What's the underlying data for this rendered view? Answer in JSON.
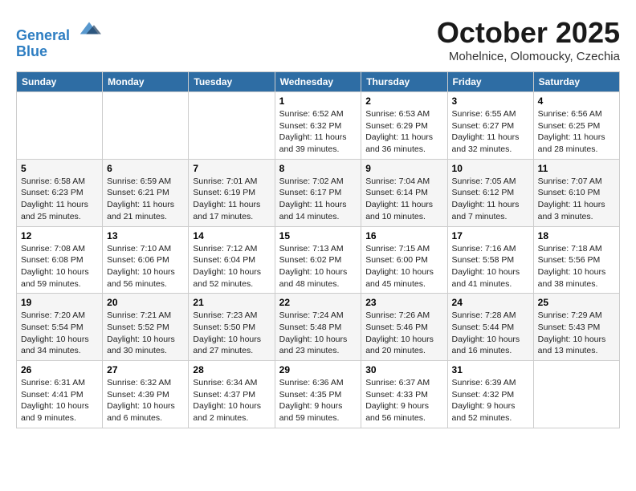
{
  "header": {
    "logo_line1": "General",
    "logo_line2": "Blue",
    "month": "October 2025",
    "location": "Mohelnice, Olomoucky, Czechia"
  },
  "weekdays": [
    "Sunday",
    "Monday",
    "Tuesday",
    "Wednesday",
    "Thursday",
    "Friday",
    "Saturday"
  ],
  "weeks": [
    [
      {
        "day": "",
        "info": ""
      },
      {
        "day": "",
        "info": ""
      },
      {
        "day": "",
        "info": ""
      },
      {
        "day": "1",
        "info": "Sunrise: 6:52 AM\nSunset: 6:32 PM\nDaylight: 11 hours\nand 39 minutes."
      },
      {
        "day": "2",
        "info": "Sunrise: 6:53 AM\nSunset: 6:29 PM\nDaylight: 11 hours\nand 36 minutes."
      },
      {
        "day": "3",
        "info": "Sunrise: 6:55 AM\nSunset: 6:27 PM\nDaylight: 11 hours\nand 32 minutes."
      },
      {
        "day": "4",
        "info": "Sunrise: 6:56 AM\nSunset: 6:25 PM\nDaylight: 11 hours\nand 28 minutes."
      }
    ],
    [
      {
        "day": "5",
        "info": "Sunrise: 6:58 AM\nSunset: 6:23 PM\nDaylight: 11 hours\nand 25 minutes."
      },
      {
        "day": "6",
        "info": "Sunrise: 6:59 AM\nSunset: 6:21 PM\nDaylight: 11 hours\nand 21 minutes."
      },
      {
        "day": "7",
        "info": "Sunrise: 7:01 AM\nSunset: 6:19 PM\nDaylight: 11 hours\nand 17 minutes."
      },
      {
        "day": "8",
        "info": "Sunrise: 7:02 AM\nSunset: 6:17 PM\nDaylight: 11 hours\nand 14 minutes."
      },
      {
        "day": "9",
        "info": "Sunrise: 7:04 AM\nSunset: 6:14 PM\nDaylight: 11 hours\nand 10 minutes."
      },
      {
        "day": "10",
        "info": "Sunrise: 7:05 AM\nSunset: 6:12 PM\nDaylight: 11 hours\nand 7 minutes."
      },
      {
        "day": "11",
        "info": "Sunrise: 7:07 AM\nSunset: 6:10 PM\nDaylight: 11 hours\nand 3 minutes."
      }
    ],
    [
      {
        "day": "12",
        "info": "Sunrise: 7:08 AM\nSunset: 6:08 PM\nDaylight: 10 hours\nand 59 minutes."
      },
      {
        "day": "13",
        "info": "Sunrise: 7:10 AM\nSunset: 6:06 PM\nDaylight: 10 hours\nand 56 minutes."
      },
      {
        "day": "14",
        "info": "Sunrise: 7:12 AM\nSunset: 6:04 PM\nDaylight: 10 hours\nand 52 minutes."
      },
      {
        "day": "15",
        "info": "Sunrise: 7:13 AM\nSunset: 6:02 PM\nDaylight: 10 hours\nand 48 minutes."
      },
      {
        "day": "16",
        "info": "Sunrise: 7:15 AM\nSunset: 6:00 PM\nDaylight: 10 hours\nand 45 minutes."
      },
      {
        "day": "17",
        "info": "Sunrise: 7:16 AM\nSunset: 5:58 PM\nDaylight: 10 hours\nand 41 minutes."
      },
      {
        "day": "18",
        "info": "Sunrise: 7:18 AM\nSunset: 5:56 PM\nDaylight: 10 hours\nand 38 minutes."
      }
    ],
    [
      {
        "day": "19",
        "info": "Sunrise: 7:20 AM\nSunset: 5:54 PM\nDaylight: 10 hours\nand 34 minutes."
      },
      {
        "day": "20",
        "info": "Sunrise: 7:21 AM\nSunset: 5:52 PM\nDaylight: 10 hours\nand 30 minutes."
      },
      {
        "day": "21",
        "info": "Sunrise: 7:23 AM\nSunset: 5:50 PM\nDaylight: 10 hours\nand 27 minutes."
      },
      {
        "day": "22",
        "info": "Sunrise: 7:24 AM\nSunset: 5:48 PM\nDaylight: 10 hours\nand 23 minutes."
      },
      {
        "day": "23",
        "info": "Sunrise: 7:26 AM\nSunset: 5:46 PM\nDaylight: 10 hours\nand 20 minutes."
      },
      {
        "day": "24",
        "info": "Sunrise: 7:28 AM\nSunset: 5:44 PM\nDaylight: 10 hours\nand 16 minutes."
      },
      {
        "day": "25",
        "info": "Sunrise: 7:29 AM\nSunset: 5:43 PM\nDaylight: 10 hours\nand 13 minutes."
      }
    ],
    [
      {
        "day": "26",
        "info": "Sunrise: 6:31 AM\nSunset: 4:41 PM\nDaylight: 10 hours\nand 9 minutes."
      },
      {
        "day": "27",
        "info": "Sunrise: 6:32 AM\nSunset: 4:39 PM\nDaylight: 10 hours\nand 6 minutes."
      },
      {
        "day": "28",
        "info": "Sunrise: 6:34 AM\nSunset: 4:37 PM\nDaylight: 10 hours\nand 2 minutes."
      },
      {
        "day": "29",
        "info": "Sunrise: 6:36 AM\nSunset: 4:35 PM\nDaylight: 9 hours\nand 59 minutes."
      },
      {
        "day": "30",
        "info": "Sunrise: 6:37 AM\nSunset: 4:33 PM\nDaylight: 9 hours\nand 56 minutes."
      },
      {
        "day": "31",
        "info": "Sunrise: 6:39 AM\nSunset: 4:32 PM\nDaylight: 9 hours\nand 52 minutes."
      },
      {
        "day": "",
        "info": ""
      }
    ]
  ]
}
